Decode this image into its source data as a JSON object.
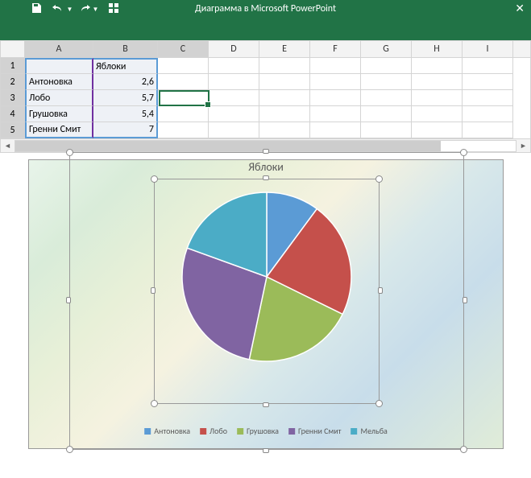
{
  "titlebar": {
    "title": "Диаграмма в Microsoft PowerPoint"
  },
  "sheet": {
    "columns": [
      "A",
      "B",
      "C",
      "D",
      "E",
      "F",
      "G",
      "H",
      "I"
    ],
    "rows": [
      {
        "n": "1",
        "a": "",
        "b": "Яблоки"
      },
      {
        "n": "2",
        "a": "Антоновка",
        "b": "2,6"
      },
      {
        "n": "3",
        "a": "Лобо",
        "b": "5,7"
      },
      {
        "n": "4",
        "a": "Грушовка",
        "b": "5,4"
      },
      {
        "n": "5",
        "a": "Гренни Смит",
        "b": "7"
      }
    ],
    "active_cell": "C3"
  },
  "chart_data": {
    "type": "pie",
    "title": "Яблоки",
    "series": [
      {
        "name": "Антоновка",
        "value": 2.6,
        "color": "#5b9bd5"
      },
      {
        "name": "Лобо",
        "value": 5.7,
        "color": "#c5504b"
      },
      {
        "name": "Грушовка",
        "value": 5.4,
        "color": "#9bbb59"
      },
      {
        "name": "Гренни Смит",
        "value": 7.0,
        "color": "#8064a2"
      },
      {
        "name": "Мельба",
        "value": 5.0,
        "color": "#4bacc6"
      }
    ]
  }
}
